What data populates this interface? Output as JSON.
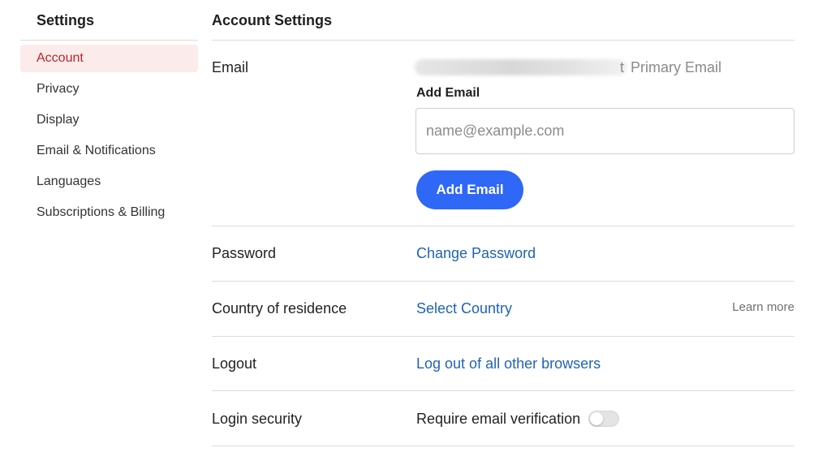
{
  "sidebar": {
    "title": "Settings",
    "items": [
      {
        "label": "Account",
        "active": true
      },
      {
        "label": "Privacy",
        "active": false
      },
      {
        "label": "Display",
        "active": false
      },
      {
        "label": "Email & Notifications",
        "active": false
      },
      {
        "label": "Languages",
        "active": false
      },
      {
        "label": "Subscriptions & Billing",
        "active": false
      }
    ]
  },
  "main": {
    "title": "Account Settings",
    "email": {
      "label": "Email",
      "visible_suffix": "t",
      "primary_tag": "Primary Email",
      "add_label": "Add Email",
      "input_placeholder": "name@example.com",
      "input_value": "",
      "button_label": "Add Email"
    },
    "password": {
      "label": "Password",
      "link": "Change Password"
    },
    "country": {
      "label": "Country of residence",
      "link": "Select Country",
      "learn_more": "Learn more"
    },
    "logout": {
      "label": "Logout",
      "link": "Log out of all other browsers"
    },
    "login_security": {
      "label": "Login security",
      "toggle_label": "Require email verification",
      "toggle_on": false
    }
  },
  "colors": {
    "accent_blue": "#2f67f6",
    "link_blue": "#1f63b4",
    "active_red": "#b8262e",
    "active_bg": "#fbeceb"
  }
}
